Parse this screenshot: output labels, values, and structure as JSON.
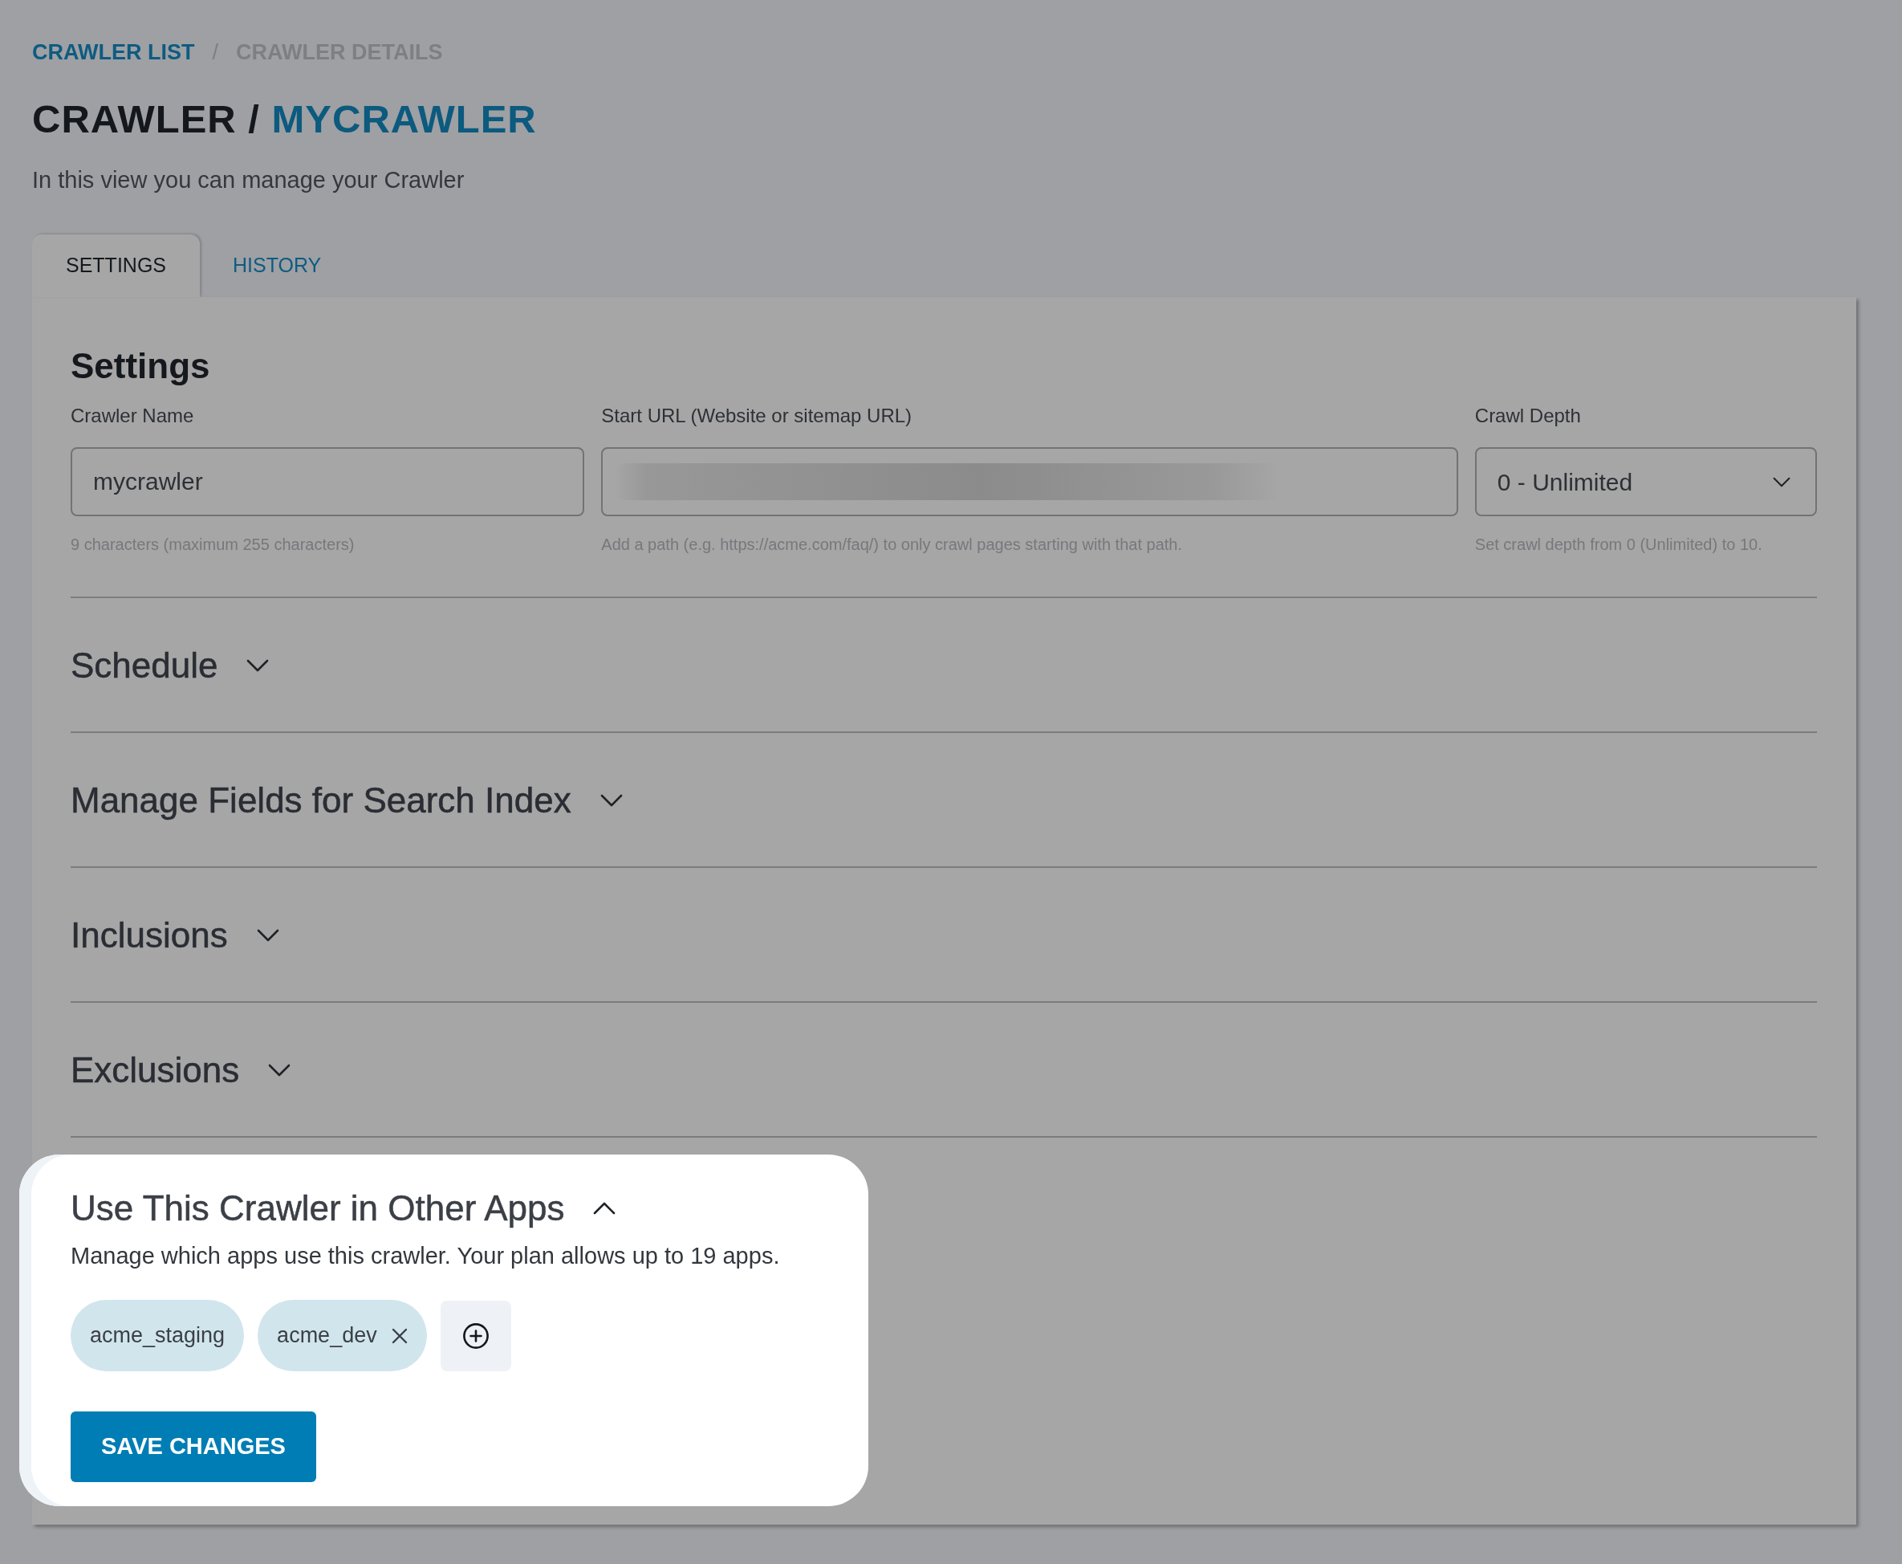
{
  "breadcrumb": {
    "separator": "/",
    "items": [
      {
        "label": "CRAWLER LIST",
        "current": false
      },
      {
        "label": "CRAWLER DETAILS",
        "current": true
      }
    ]
  },
  "header": {
    "title": "CRAWLER /",
    "title_highlight": "MYCRAWLER",
    "subtitle": "In this view you can manage your Crawler"
  },
  "tabs": [
    {
      "label": "SETTINGS",
      "selected": true
    },
    {
      "label": "HISTORY",
      "selected": false
    }
  ],
  "settings": {
    "heading": "Settings",
    "fields": [
      {
        "kind": "text",
        "label": "Crawler Name",
        "value": "mycrawler",
        "redacted": false,
        "help": "9 characters (maximum 255 characters)"
      },
      {
        "kind": "text",
        "label": "Start URL (Website or sitemap URL)",
        "redacted": true,
        "help": "Add a path (e.g. https://acme.com/faq/) to only crawl pages starting with that path."
      },
      {
        "kind": "select",
        "label": "Crawl Depth",
        "value": "0 - Unlimited",
        "redacted": false,
        "help": "Set crawl depth from 0 (Unlimited) to 10."
      }
    ]
  },
  "sections": [
    {
      "title": "Schedule",
      "expanded": false
    },
    {
      "title": "Manage Fields for Search Index",
      "expanded": false
    },
    {
      "title": "Inclusions",
      "expanded": false
    },
    {
      "title": "Exclusions",
      "expanded": false
    }
  ],
  "apps_section": {
    "title": "Use This Crawler in Other Apps",
    "expanded": true,
    "highlighted": true,
    "description": "Manage which apps use this crawler. Your plan allows up to 19 apps.",
    "apps": [
      {
        "name": "acme_staging",
        "removable": false
      },
      {
        "name": "acme_dev",
        "removable": true
      }
    ]
  },
  "save_button": {
    "label": "SAVE CHANGES"
  }
}
